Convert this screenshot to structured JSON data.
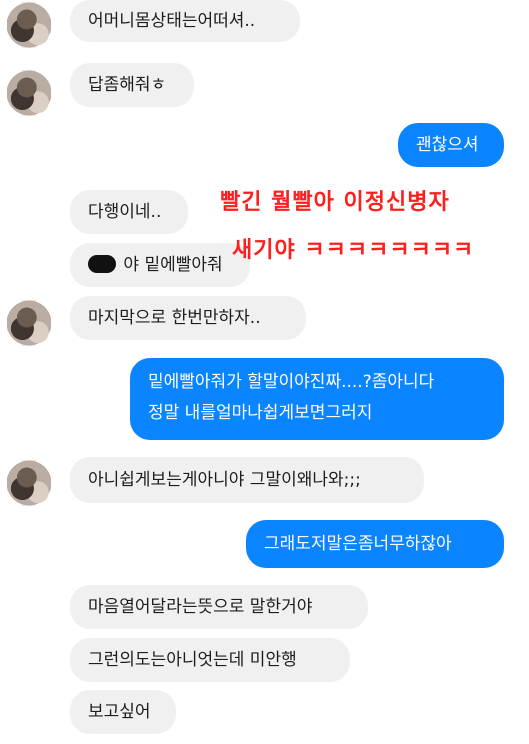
{
  "colors": {
    "incoming_bg": "#f1f0f0",
    "outgoing_bg": "#0a84ff",
    "overlay_text": "#ff1e1e"
  },
  "messages": [
    {
      "id": "m1",
      "side": "in",
      "text": "어머니몸상태는어떠셔.."
    },
    {
      "id": "m2",
      "side": "in",
      "text": "답좀해줘ㅎ"
    },
    {
      "id": "m3",
      "side": "out",
      "text": "괜찮으셔"
    },
    {
      "id": "m4",
      "side": "in",
      "text": "다행이네.."
    },
    {
      "id": "m5",
      "side": "in",
      "prefix_icon": "scribble-redaction-icon",
      "text": "야 밑에빨아줘"
    },
    {
      "id": "m6",
      "side": "in",
      "text": "마지막으로 한번만하자.."
    },
    {
      "id": "m7",
      "side": "out",
      "line1": "밑에빨아줘가 할말이야진짜....?좀아니다",
      "line2": "정말 내를얼마나쉽게보면그러지"
    },
    {
      "id": "m8",
      "side": "in",
      "text": "아니쉽게보는게아니야 그말이왜나와;;;"
    },
    {
      "id": "m9",
      "side": "out",
      "text": "그래도저말은좀너무하잖아"
    },
    {
      "id": "m10",
      "side": "in",
      "text": "마음열어달라는뜻으로 말한거야"
    },
    {
      "id": "m11",
      "side": "in",
      "text": "그런의도는아니엇는데 미안행"
    },
    {
      "id": "m12",
      "side": "in",
      "text": "보고싶어"
    }
  ],
  "overlay": {
    "line1": "빨긴 뭘빨아 이정신병자",
    "line2": "새기야 ㅋㅋㅋㅋㅋㅋㅋㅋ"
  }
}
